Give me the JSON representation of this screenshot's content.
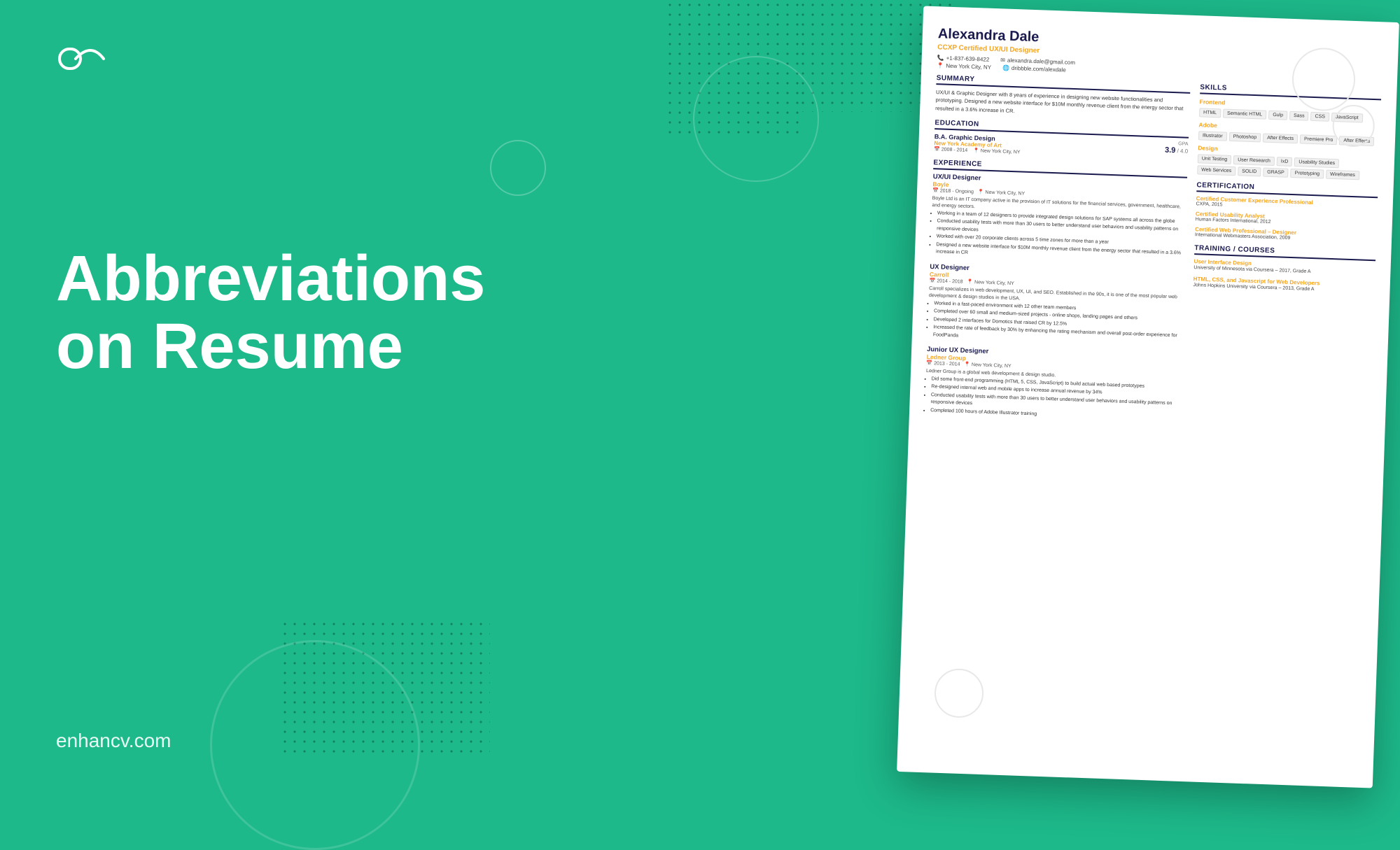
{
  "logo": {
    "alt": "enhancv logo"
  },
  "title_line1": "Abbreviations",
  "title_line2": "on Resume",
  "website": "enhancv.com",
  "resume": {
    "name": "Alexandra Dale",
    "title": "CCXP Certified UX/UI Designer",
    "phone": "+1-837-639-8422",
    "email": "alexandra.dale@gmail.com",
    "location": "New York City, NY",
    "portfolio": "dribbble.com/alexdale",
    "summary": {
      "heading": "SUMMARY",
      "text": "UX/UI & Graphic Designer with 8 years of experience in designing new website functionalities and prototyping. Designed a new website interface for $10M monthly revenue client from the energy sector that resulted in a 3.6% increase in CR."
    },
    "education": {
      "heading": "EDUCATION",
      "degree": "B.A. Graphic Design",
      "school": "New York Academy of Art",
      "years": "2008 - 2014",
      "location": "New York City, NY",
      "gpa_label": "GPA",
      "gpa_value": "3.9",
      "gpa_max": "4.0"
    },
    "experience": {
      "heading": "EXPERIENCE",
      "jobs": [
        {
          "title": "UX/UI Designer",
          "company": "Boyle",
          "years": "2018 - Ongoing",
          "location": "New York City, NY",
          "description": "Boyle Ltd is an IT company active in the provision of IT solutions for the financial services, government, healthcare, and energy sectors.",
          "bullets": [
            "Working in a team of 12 designers to provide integrated design solutions for SAP systems all across the globe",
            "Conducted usability tests with more than 30 users to better understand user behaviors and usability patterns on responsive devices",
            "Worked with over 20 corporate clients across 5 time zones for more than a year",
            "Designed a new website interface for $10M monthly revenue client from the energy sector that resulted in a 3.6% increase in CR"
          ]
        },
        {
          "title": "UX Designer",
          "company": "Carroll",
          "years": "2014 - 2018",
          "location": "New York City, NY",
          "description": "Carroll specializes in web development, UX, UI, and SEO. Established in the 90s, it is one of the most popular web development & design studios in the USA.",
          "bullets": [
            "Worked in a fast-paced environment with 12 other team members",
            "Completed over 60 small and medium-sized projects - online shops, landing pages and others",
            "Developed 2 interfaces for Domotics that raised CR by 12.5%",
            "Increased the rate of feedback by 30% by enhancing the rating mechanism and overall post-order experience for FoodPanda"
          ]
        },
        {
          "title": "Junior UX Designer",
          "company": "Ledner Group",
          "years": "2013 - 2014",
          "location": "New York City, NY",
          "description": "Ledner Group is a global web development & design studio.",
          "bullets": [
            "Did some front-end programming (HTML 5, CSS, JavaScript) to build actual web based prototypes",
            "Re-designed internal web and mobile apps to increase annual revenue by 34%",
            "Conducted usability tests with more than 30 users to better understand user behaviors and usability patterns on responsive devices",
            "Completed 100 hours of Adobe Illustrator training"
          ]
        }
      ]
    },
    "skills": {
      "heading": "SKILLS",
      "categories": [
        {
          "name": "Frontend",
          "tags": [
            "HTML",
            "Semantic HTML",
            "Gulp",
            "Sass",
            "CSS",
            "JavaScript"
          ]
        },
        {
          "name": "Adobe",
          "tags": [
            "Illustrator",
            "Photoshop",
            "After Effects",
            "Premiere Pro",
            "After Effects"
          ]
        },
        {
          "name": "Design",
          "tags": [
            "Unit Testing",
            "User Research",
            "IxD",
            "Usability Studies",
            "Web Services",
            "SOLID",
            "GRASP",
            "Prototyping",
            "Wireframes"
          ]
        }
      ]
    },
    "certification": {
      "heading": "CERTIFICATION",
      "items": [
        {
          "name": "Certified Customer Experience Professional",
          "org": "CXPA, 2015"
        },
        {
          "name": "Certified Usability Analyst",
          "org": "Human Factors International, 2012"
        },
        {
          "name": "Certified Web Professional – Designer",
          "org": "International Webmasters Association, 2009"
        }
      ]
    },
    "training": {
      "heading": "TRAINING / COURSES",
      "items": [
        {
          "name": "User Interface Design",
          "detail": "University of Minnesota via Coursera – 2017, Grade A"
        },
        {
          "name": "HTML, CSS, and Javascript for Web Developers",
          "detail": "Johns Hopkins University via Coursera – 2013, Grade A"
        }
      ]
    }
  }
}
